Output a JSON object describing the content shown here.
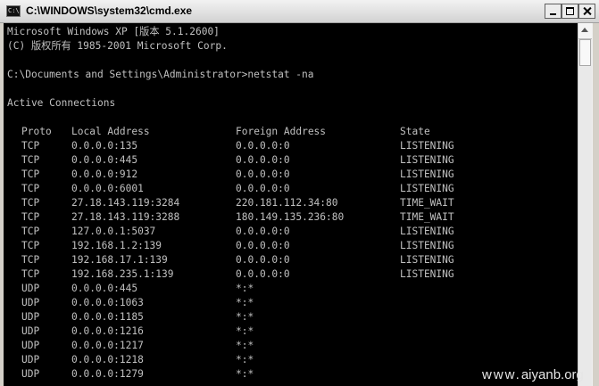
{
  "window": {
    "title": "C:\\WINDOWS\\system32\\cmd.exe",
    "icon": "cmd-icon",
    "icon_text": "C:\\"
  },
  "console": {
    "banner": "Microsoft Windows XP [版本 5.1.2600]",
    "copyright": "(C) 版权所有 1985-2001 Microsoft Corp.",
    "prompt": "C:\\Documents and Settings\\Administrator>netstat -na",
    "section_title": "Active Connections",
    "headers": [
      "Proto",
      "Local Address",
      "Foreign Address",
      "State"
    ],
    "rows": [
      [
        "TCP",
        "0.0.0.0:135",
        "0.0.0.0:0",
        "LISTENING"
      ],
      [
        "TCP",
        "0.0.0.0:445",
        "0.0.0.0:0",
        "LISTENING"
      ],
      [
        "TCP",
        "0.0.0.0:912",
        "0.0.0.0:0",
        "LISTENING"
      ],
      [
        "TCP",
        "0.0.0.0:6001",
        "0.0.0.0:0",
        "LISTENING"
      ],
      [
        "TCP",
        "27.18.143.119:3284",
        "220.181.112.34:80",
        "TIME_WAIT"
      ],
      [
        "TCP",
        "27.18.143.119:3288",
        "180.149.135.236:80",
        "TIME_WAIT"
      ],
      [
        "TCP",
        "127.0.0.1:5037",
        "0.0.0.0:0",
        "LISTENING"
      ],
      [
        "TCP",
        "192.168.1.2:139",
        "0.0.0.0:0",
        "LISTENING"
      ],
      [
        "TCP",
        "192.168.17.1:139",
        "0.0.0.0:0",
        "LISTENING"
      ],
      [
        "TCP",
        "192.168.235.1:139",
        "0.0.0.0:0",
        "LISTENING"
      ],
      [
        "UDP",
        "0.0.0.0:445",
        "*:*",
        ""
      ],
      [
        "UDP",
        "0.0.0.0:1063",
        "*:*",
        ""
      ],
      [
        "UDP",
        "0.0.0.0:1185",
        "*:*",
        ""
      ],
      [
        "UDP",
        "0.0.0.0:1216",
        "*:*",
        ""
      ],
      [
        "UDP",
        "0.0.0.0:1217",
        "*:*",
        ""
      ],
      [
        "UDP",
        "0.0.0.0:1218",
        "*:*",
        ""
      ],
      [
        "UDP",
        "0.0.0.0:1279",
        "*:*",
        ""
      ]
    ]
  },
  "watermark": {
    "dots": "www.",
    "text": "aiyanb.org"
  },
  "colors": {
    "console_background": "#000000",
    "console_text": "#c0c0c0"
  }
}
